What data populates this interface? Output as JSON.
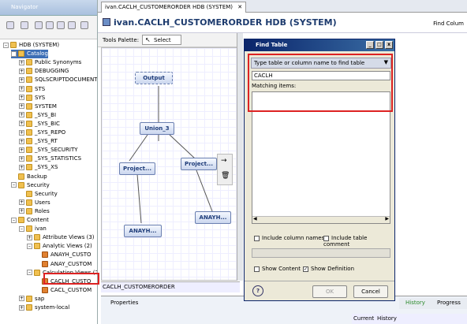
{
  "navigator": {
    "title": "Navigator",
    "items": [
      {
        "label": "HDB (SYSTEM)",
        "indent": 0,
        "exp": "–",
        "icon": "sys"
      },
      {
        "label": "Catalog",
        "indent": 1,
        "exp": "–",
        "icon": "folder",
        "selected": true
      },
      {
        "label": "Public Synonyms",
        "indent": 2,
        "exp": "+",
        "icon": "folder"
      },
      {
        "label": "DEBUGGING",
        "indent": 2,
        "exp": "+",
        "icon": "folder"
      },
      {
        "label": "SQLSCRIPTDOCUMENT",
        "indent": 2,
        "exp": "+",
        "icon": "folder"
      },
      {
        "label": "STS",
        "indent": 2,
        "exp": "+",
        "icon": "folder"
      },
      {
        "label": "SYS",
        "indent": 2,
        "exp": "+",
        "icon": "folder"
      },
      {
        "label": "SYSTEM",
        "indent": 2,
        "exp": "+",
        "icon": "folder"
      },
      {
        "label": "_SYS_BI",
        "indent": 2,
        "exp": "+",
        "icon": "folder"
      },
      {
        "label": "_SYS_BIC",
        "indent": 2,
        "exp": "+",
        "icon": "folder"
      },
      {
        "label": "_SYS_REPO",
        "indent": 2,
        "exp": "+",
        "icon": "folder"
      },
      {
        "label": "_SYS_RT",
        "indent": 2,
        "exp": "+",
        "icon": "folder"
      },
      {
        "label": "_SYS_SECURITY",
        "indent": 2,
        "exp": "+",
        "icon": "folder"
      },
      {
        "label": "_SYS_STATISTICS",
        "indent": 2,
        "exp": "+",
        "icon": "folder"
      },
      {
        "label": "_SYS_XS",
        "indent": 2,
        "exp": "+",
        "icon": "folder"
      },
      {
        "label": "Backup",
        "indent": 1,
        "exp": "",
        "icon": "folder"
      },
      {
        "label": "Security",
        "indent": 1,
        "exp": "–",
        "icon": "folder"
      },
      {
        "label": "Security",
        "indent": 2,
        "exp": "",
        "icon": "folder"
      },
      {
        "label": "Users",
        "indent": 2,
        "exp": "+",
        "icon": "folder"
      },
      {
        "label": "Roles",
        "indent": 2,
        "exp": "+",
        "icon": "folder"
      },
      {
        "label": "Content",
        "indent": 1,
        "exp": "–",
        "icon": "folder"
      },
      {
        "label": "ivan",
        "indent": 2,
        "exp": "–",
        "icon": "folder"
      },
      {
        "label": "Attribute Views (3)",
        "indent": 3,
        "exp": "+",
        "icon": "folder"
      },
      {
        "label": "Analytic Views (2)",
        "indent": 3,
        "exp": "–",
        "icon": "folder"
      },
      {
        "label": "ANAYH_CUSTO",
        "indent": 4,
        "exp": "",
        "icon": "view"
      },
      {
        "label": "ANAY_CUSTOM",
        "indent": 4,
        "exp": "",
        "icon": "view"
      },
      {
        "label": "Calculation Views (2",
        "indent": 3,
        "exp": "–",
        "icon": "folder"
      },
      {
        "label": "CACLH_CUSTO",
        "indent": 4,
        "exp": "",
        "icon": "view"
      },
      {
        "label": "CACL_CUSTOM",
        "indent": 4,
        "exp": "",
        "icon": "view"
      },
      {
        "label": "sap",
        "indent": 2,
        "exp": "+",
        "icon": "folder"
      },
      {
        "label": "system-local",
        "indent": 2,
        "exp": "+",
        "icon": "folder"
      }
    ]
  },
  "editor": {
    "tab_label": "ivan.CACLH_CUSTOMERORDER HDB (SYSTEM)",
    "title": "ivan.CACLH_CUSTOMERORDER HDB (SYSTEM)",
    "find_column": "Find Colum",
    "palette_label": "Tools Palette:",
    "select_label": "Select",
    "nodes": {
      "output": "Output",
      "union": "Union_3",
      "proj1": "Project...",
      "proj2": "Project...",
      "anayh1": "ANAYH...",
      "anayh2": "ANAYH..."
    },
    "bottom_tab": "CACLH_CUSTOMERORDER",
    "properties_tab": "Properties"
  },
  "dialog": {
    "title": "Find Table",
    "prompt": "Type table or column name to find table",
    "input_value": "CACLH",
    "matching_label": "Matching items:",
    "include_columns": "Include column names",
    "include_comment": "Include table comment",
    "show_content": "Show Content",
    "show_definition": "Show Definition",
    "ok": "OK",
    "cancel": "Cancel",
    "help": "?"
  },
  "bottom_right": {
    "history": "History",
    "progress": "Progress",
    "current": "Current",
    "history2": "History"
  }
}
